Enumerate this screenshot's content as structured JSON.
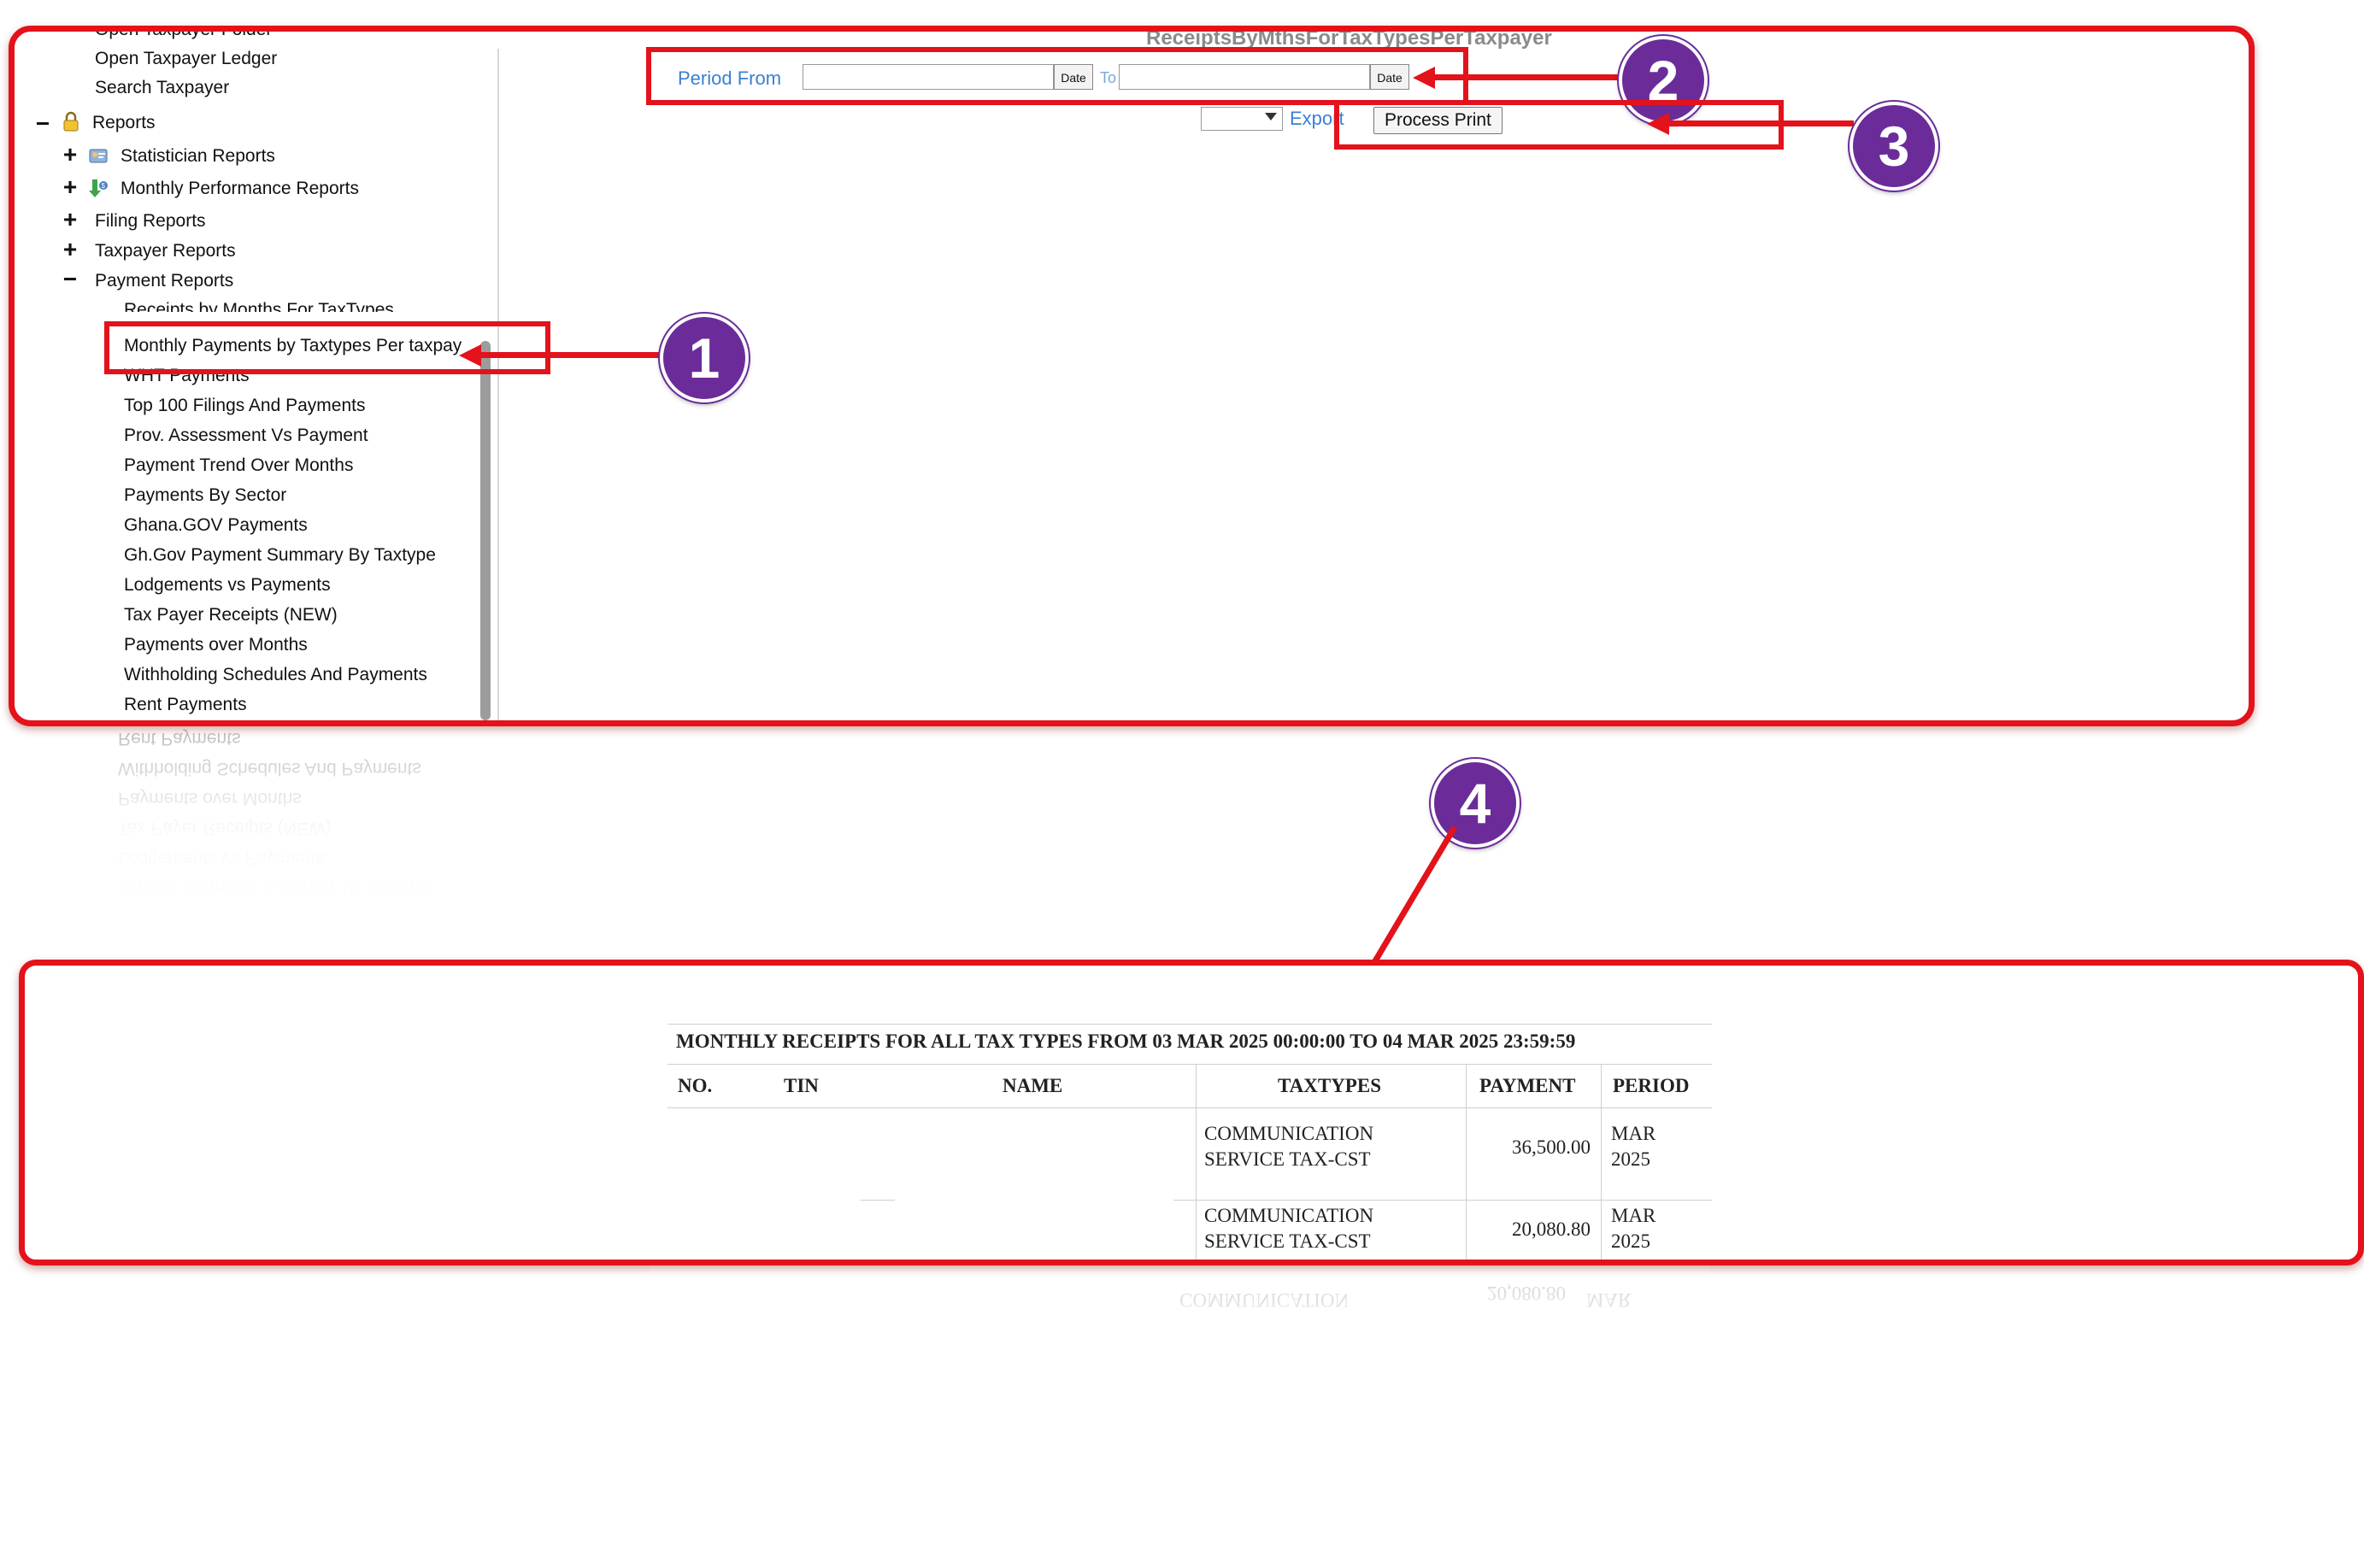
{
  "sidebar": {
    "top_items": [
      {
        "label": "Open Taxpayer Folder"
      },
      {
        "label": "Open Taxpayer Ledger"
      },
      {
        "label": "Search Taxpayer"
      }
    ],
    "reports": {
      "label": "Reports",
      "expander": "−",
      "icon": "lock-icon"
    },
    "report_groups": [
      {
        "label": "Statistician Reports",
        "expander": "+",
        "icon": "statistician-icon"
      },
      {
        "label": "Monthly Performance Reports",
        "expander": "+",
        "icon": "performance-icon"
      },
      {
        "label": "Filing Reports",
        "expander": "+"
      },
      {
        "label": "Taxpayer Reports",
        "expander": "+"
      },
      {
        "label": "Payment Reports",
        "expander": "−"
      }
    ],
    "payment_reports": [
      {
        "label": "Receipts by Months For TaxTypes"
      },
      {
        "label": "Monthly Payments by Taxtypes Per taxpayer"
      },
      {
        "label": "WHT Payments"
      },
      {
        "label": "Top 100 Filings And Payments"
      },
      {
        "label": "Prov. Assessment Vs Payment"
      },
      {
        "label": "Payment Trend Over Months"
      },
      {
        "label": "Payments By Sector"
      },
      {
        "label": "Ghana.GOV Payments"
      },
      {
        "label": "Gh.Gov Payment Summary By Taxtype"
      },
      {
        "label": "Lodgements vs Payments"
      },
      {
        "label": "Tax Payer Receipts (NEW)"
      },
      {
        "label": "Payments over Months"
      },
      {
        "label": "Withholding Schedules And Payments"
      },
      {
        "label": "Rent Payments"
      }
    ]
  },
  "main": {
    "title": "ReceiptsByMthsForTaxTypesPerTaxpayer",
    "period_from_label": "Period From",
    "period_from_value": "",
    "date_button": "Date",
    "to_label": "To",
    "period_to_value": "",
    "export_select_value": "",
    "export_label": "Export",
    "process_print": "Process Print"
  },
  "callouts": [
    "1",
    "2",
    "3",
    "4"
  ],
  "report": {
    "title": "MONTHLY RECEIPTS FOR ALL TAX TYPES FROM 03 MAR 2025 00:00:00 TO 04 MAR 2025 23:59:59",
    "columns": [
      "NO.",
      "TIN",
      "NAME",
      "TAXTYPES",
      "PAYMENT",
      "PERIOD"
    ],
    "rows": [
      {
        "taxtype_1": "COMMUNICATION",
        "taxtype_2": "SERVICE TAX-CST",
        "payment": "36,500.00",
        "period_1": "MAR",
        "period_2": "2025"
      },
      {
        "taxtype_1": "COMMUNICATION",
        "taxtype_2": "SERVICE TAX-CST",
        "payment": "20,080.80",
        "period_1": "MAR",
        "period_2": "2025"
      }
    ]
  },
  "colors": {
    "accent_red": "#e3121b",
    "badge_purple": "#6b2c9a",
    "link_blue": "#3a7fd5"
  }
}
